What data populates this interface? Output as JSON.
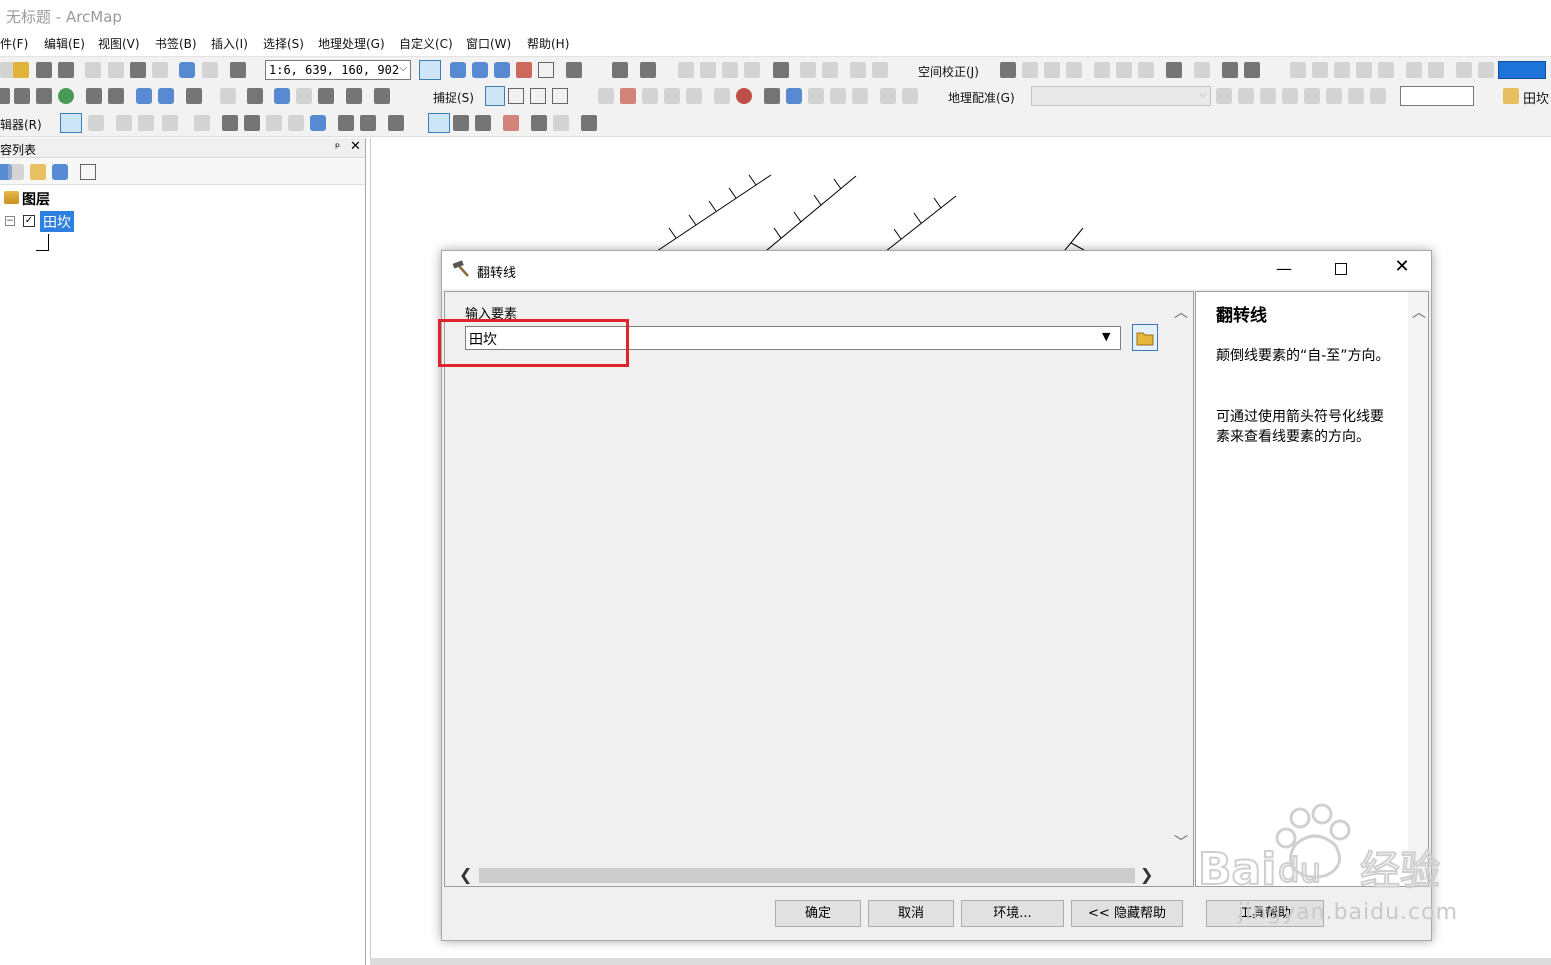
{
  "app": {
    "title": "无标题 - ArcMap"
  },
  "menubar": {
    "items": [
      "文件(F)",
      "编辑(E)",
      "视图(V)",
      "书签(B)",
      "插入(I)",
      "选择(S)",
      "地理处理(G)",
      "自定义(C)",
      "窗口(W)",
      "帮助(H)"
    ]
  },
  "toolbar": {
    "scale_value": "1:6, 639, 160, 902",
    "spatial_adjust_label": "空间校正(J)",
    "snapping_label": "捕捉(S)",
    "georef_label": "地理配准(G)",
    "layer_combo_value": "田坎",
    "editor_label": "编辑器(R)"
  },
  "toc": {
    "title": "内容列表",
    "root_label": "图层",
    "layer_name": "田坎",
    "pin_label": "ᵖ",
    "close_label": "✕"
  },
  "dialog": {
    "title": "翻转线",
    "param_label": "输入要素",
    "input_value": "田坎",
    "help": {
      "title": "翻转线",
      "p1": "颠倒线要素的“自-至”方向。",
      "p2": "可通过使用箭头符号化线要素来查看线要素的方向。"
    },
    "buttons": {
      "ok": "确定",
      "cancel": "取消",
      "env": "环境...",
      "hide_help": "<< 隐藏帮助",
      "tool_help": "工具帮助"
    }
  },
  "watermark": {
    "text": "jingyan.baidu.com",
    "logo": "Baidu 经验"
  },
  "colors": {
    "selection": "#2d7fe0",
    "highlight": "#e0242b",
    "accent": "#3c78b8"
  }
}
